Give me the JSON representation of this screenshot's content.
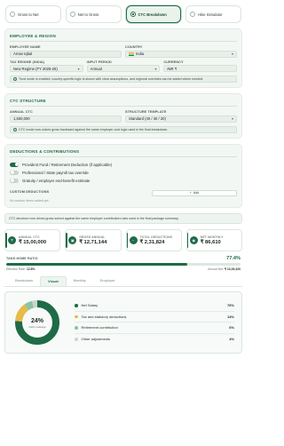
{
  "modes": [
    {
      "label": "Gross to Net",
      "active": false
    },
    {
      "label": "Net to Gross",
      "active": false
    },
    {
      "label": "CTC Breakdown",
      "active": true
    },
    {
      "label": "Hike Simulator",
      "active": false
    }
  ],
  "employee": {
    "section_title": "EMPLOYEE & REGION",
    "name_label": "EMPLOYEE NAME",
    "name_value": "Arnav Iqbal",
    "country_label": "COUNTRY",
    "country_value": "India",
    "regime_label": "TAX REGIME (INDIA)",
    "regime_value": "New Regime (FY 2025-26)",
    "period_label": "INPUT PERIOD",
    "period_value": "Annual",
    "currency_label": "CURRENCY",
    "currency_value": "INR ₹",
    "note": "Trust mode is enabled; country-specific logic is shown with clear assumptions, and regional overrides can be added where needed."
  },
  "ctc": {
    "section_title": "CTC STRUCTURE",
    "annual_label": "ANNUAL CTC",
    "annual_value": "1,500,000",
    "template_label": "STRUCTURE TEMPLATE",
    "template_value": "Standard (40 / 40 / 20)",
    "note": "CTC mode now solves gross backward against the same employer cost logic used in the final breakdown."
  },
  "deductions": {
    "section_title": "DEDUCTIONS & CONTRIBUTIONS",
    "toggles": [
      {
        "label": "Provident Fund / Retirement Deduction (if applicable)",
        "on": true
      },
      {
        "label": "Professional / State payroll tax override",
        "on": false
      },
      {
        "label": "Gratuity / employer end-benefit estimate",
        "on": false
      }
    ],
    "custom_label": "CUSTOM DEDUCTIONS",
    "add_label": "Add",
    "empty_text": "No custom items added yet."
  },
  "banner": "CTC structure now drives gross solved against the same employer contribution rules used in the final package summary.",
  "stats": [
    {
      "label": "ANNUAL CTC",
      "value": "₹ 15,00,000",
      "icon": "rupee-icon"
    },
    {
      "label": "GROSS ANNUAL",
      "value": "₹ 12,71,144",
      "icon": "wallet-icon"
    },
    {
      "label": "TOTAL DEDUCTIONS",
      "value": "₹ 2,31,824",
      "icon": "minus-icon"
    },
    {
      "label": "NET MONTHLY",
      "value": "₹ 86,610",
      "icon": "coins-icon"
    }
  ],
  "ratio": {
    "label": "TAKE-HOME RATIO",
    "value": "77.4%",
    "fill_pct": 77.4,
    "effective_label": "Effective Rate:",
    "effective_value": "12.8%",
    "annual_net_label": "Annual Net:",
    "annual_net_value": "₹ 10,39,320"
  },
  "view_tabs": [
    {
      "label": "Breakdown",
      "active": false
    },
    {
      "label": "Visual",
      "active": true
    },
    {
      "label": "Monthly",
      "active": false
    },
    {
      "label": "Employer",
      "active": false
    }
  ],
  "donut": {
    "center_value": "24%",
    "center_label": "Cash Leakage",
    "segments": [
      {
        "name": "Net Salary",
        "pct": 76,
        "color": "#1f6b47"
      },
      {
        "name": "Tax and statutory deductions",
        "pct": 14,
        "color": "#e9b949"
      },
      {
        "name": "Retirement contribution",
        "pct": 6,
        "color": "#8bc3a3"
      },
      {
        "name": "Other adjustments",
        "pct": 4,
        "color": "#c9d6cd"
      }
    ],
    "labels": [
      "76%",
      "14%",
      "6%",
      "4%"
    ]
  }
}
